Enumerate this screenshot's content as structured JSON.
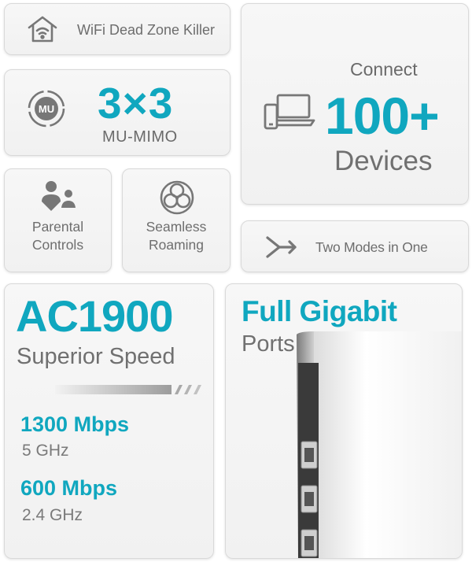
{
  "colors": {
    "accent": "#10a7bf",
    "text": "#6b6b6b",
    "card_bg": "#f3f3f3",
    "card_border": "#d9d9d9"
  },
  "features": {
    "dead_zone": {
      "icon": "wifi-home-icon",
      "label": "WiFi Dead Zone Killer"
    },
    "mimo": {
      "icon": "mu-badge-icon",
      "value": "3×3",
      "label": "MU-MIMO"
    },
    "connect": {
      "icon": "laptop-phone-icon",
      "line1": "Connect",
      "value": "100+",
      "line3": "Devices"
    },
    "parental": {
      "icon": "family-icon",
      "label_line1": "Parental",
      "label_line2": "Controls"
    },
    "seamless": {
      "icon": "rings-icon",
      "label_line1": "Seamless",
      "label_line2": "Roaming"
    },
    "modes": {
      "icon": "merge-arrows-icon",
      "label": "Two Modes in One"
    }
  },
  "speed": {
    "title": "AC1900",
    "subtitle": "Superior Speed",
    "bands": [
      {
        "rate": "1300 Mbps",
        "band": "5 GHz"
      },
      {
        "rate": "600 Mbps",
        "band": "2.4 GHz"
      }
    ]
  },
  "gigabit": {
    "title": "Full Gigabit",
    "subtitle": "Ports",
    "image": "router-ports-image"
  }
}
